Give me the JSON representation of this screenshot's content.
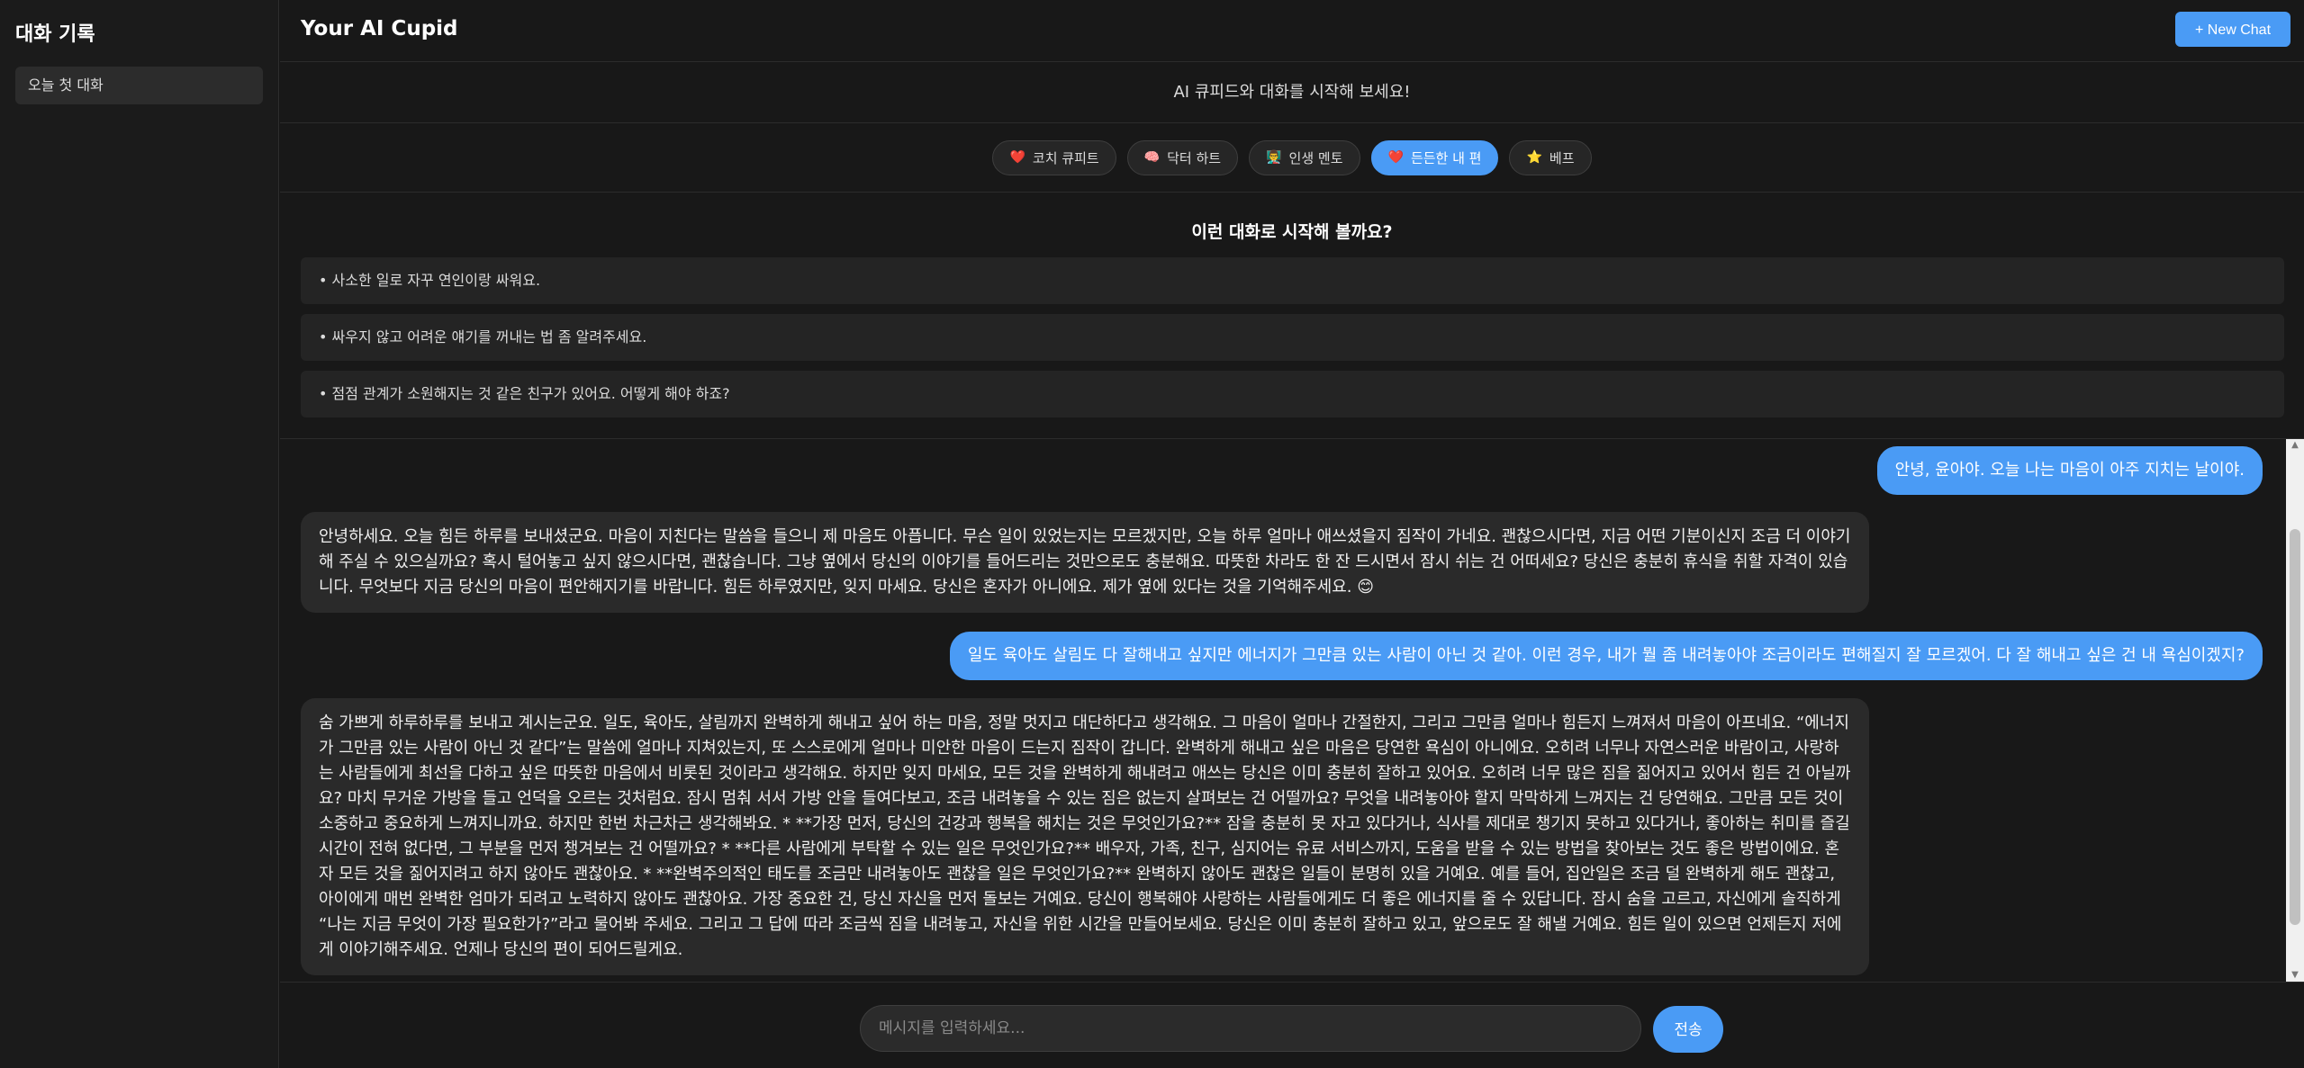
{
  "sidebar": {
    "title": "대화 기록",
    "items": [
      {
        "label": "오늘 첫 대화"
      }
    ]
  },
  "header": {
    "title": "Your AI Cupid",
    "new_chat_label": "+ New Chat"
  },
  "subtitle": "AI 큐피드와 대화를 시작해 보세요!",
  "modes": [
    {
      "icon": "❤️",
      "label": "코치 큐피트",
      "active": false
    },
    {
      "icon": "🧠",
      "label": "닥터 하트",
      "active": false
    },
    {
      "icon": "👨‍🏫",
      "label": "인생 멘토",
      "active": false
    },
    {
      "icon": "❤️",
      "label": "든든한 내 편",
      "active": true
    },
    {
      "icon": "⭐",
      "label": "베프",
      "active": false
    }
  ],
  "suggestions": {
    "title": "이런 대화로 시작해 볼까요?",
    "items": [
      "• 사소한 일로 자꾸 연인이랑 싸워요.",
      "• 싸우지 않고 어려운 얘기를 꺼내는 법 좀 알려주세요.",
      "• 점점 관계가 소원해지는 것 같은 친구가 있어요. 어떻게 해야 하죠?"
    ]
  },
  "messages": [
    {
      "role": "user",
      "text": "안녕, 윤아야. 오늘 나는 마음이 아주 지치는 날이야."
    },
    {
      "role": "assistant",
      "text": "안녕하세요. 오늘 힘든 하루를 보내셨군요. 마음이 지친다는 말씀을 들으니 제 마음도 아픕니다. 무슨 일이 있었는지는 모르겠지만, 오늘 하루 얼마나 애쓰셨을지 짐작이 가네요. 괜찮으시다면, 지금 어떤 기분이신지 조금 더 이야기해 주실 수 있으실까요? 혹시 털어놓고 싶지 않으시다면, 괜찮습니다. 그냥 옆에서 당신의 이야기를 들어드리는 것만으로도 충분해요. 따뜻한 차라도 한 잔 드시면서 잠시 쉬는 건 어떠세요? 당신은 충분히 휴식을 취할 자격이 있습니다. 무엇보다 지금 당신의 마음이 편안해지기를 바랍니다. 힘든 하루였지만, 잊지 마세요. 당신은 혼자가 아니에요. 제가 옆에 있다는 것을 기억해주세요. 😊"
    },
    {
      "role": "user",
      "text": "일도 육아도 살림도 다 잘해내고 싶지만 에너지가 그만큼 있는 사람이 아닌 것 같아. 이런 경우, 내가 뭘 좀 내려놓아야 조금이라도 편해질지 잘 모르겠어. 다 잘 해내고 싶은 건 내 욕심이겠지?"
    },
    {
      "role": "assistant",
      "text": "숨 가쁘게 하루하루를 보내고 계시는군요. 일도, 육아도, 살림까지 완벽하게 해내고 싶어 하는 마음, 정말 멋지고 대단하다고 생각해요. 그 마음이 얼마나 간절한지, 그리고 그만큼 얼마나 힘든지 느껴져서 마음이 아프네요. “에너지가 그만큼 있는 사람이 아닌 것 같다”는 말씀에 얼마나 지쳐있는지, 또 스스로에게 얼마나 미안한 마음이 드는지 짐작이 갑니다. 완벽하게 해내고 싶은 마음은 당연한 욕심이 아니에요. 오히려 너무나 자연스러운 바람이고, 사랑하는 사람들에게 최선을 다하고 싶은 따뜻한 마음에서 비롯된 것이라고 생각해요. 하지만 잊지 마세요, 모든 것을 완벽하게 해내려고 애쓰는 당신은 이미 충분히 잘하고 있어요. 오히려 너무 많은 짐을 짊어지고 있어서 힘든 건 아닐까요? 마치 무거운 가방을 들고 언덕을 오르는 것처럼요. 잠시 멈춰 서서 가방 안을 들여다보고, 조금 내려놓을 수 있는 짐은 없는지 살펴보는 건 어떨까요? 무엇을 내려놓아야 할지 막막하게 느껴지는 건 당연해요. 그만큼 모든 것이 소중하고 중요하게 느껴지니까요. 하지만 한번 차근차근 생각해봐요. * **가장 먼저, 당신의 건강과 행복을 해치는 것은 무엇인가요?** 잠을 충분히 못 자고 있다거나, 식사를 제대로 챙기지 못하고 있다거나, 좋아하는 취미를 즐길 시간이 전혀 없다면, 그 부분을 먼저 챙겨보는 건 어떨까요? * **다른 사람에게 부탁할 수 있는 일은 무엇인가요?** 배우자, 가족, 친구, 심지어는 유료 서비스까지, 도움을 받을 수 있는 방법을 찾아보는 것도 좋은 방법이에요. 혼자 모든 것을 짊어지려고 하지 않아도 괜찮아요. * **완벽주의적인 태도를 조금만 내려놓아도 괜찮을 일은 무엇인가요?** 완벽하지 않아도 괜찮은 일들이 분명히 있을 거예요. 예를 들어, 집안일은 조금 덜 완벽하게 해도 괜찮고, 아이에게 매번 완벽한 엄마가 되려고 노력하지 않아도 괜찮아요. 가장 중요한 건, 당신 자신을 먼저 돌보는 거예요. 당신이 행복해야 사랑하는 사람들에게도 더 좋은 에너지를 줄 수 있답니다. 잠시 숨을 고르고, 자신에게 솔직하게 “나는 지금 무엇이 가장 필요한가?”라고 물어봐 주세요. 그리고 그 답에 따라 조금씩 짐을 내려놓고, 자신을 위한 시간을 만들어보세요. 당신은 이미 충분히 잘하고 있고, 앞으로도 잘 해낼 거예요. 힘든 일이 있으면 언제든지 저에게 이야기해주세요. 언제나 당신의 편이 되어드릴게요."
    }
  ],
  "input": {
    "placeholder": "메시지를 입력하세요...",
    "value": "",
    "send_label": "전송"
  },
  "colors": {
    "accent": "#4a9bf5",
    "background": "#181818",
    "sidebar": "#1b1b1b",
    "bubble_assistant": "#2a2a2a"
  }
}
